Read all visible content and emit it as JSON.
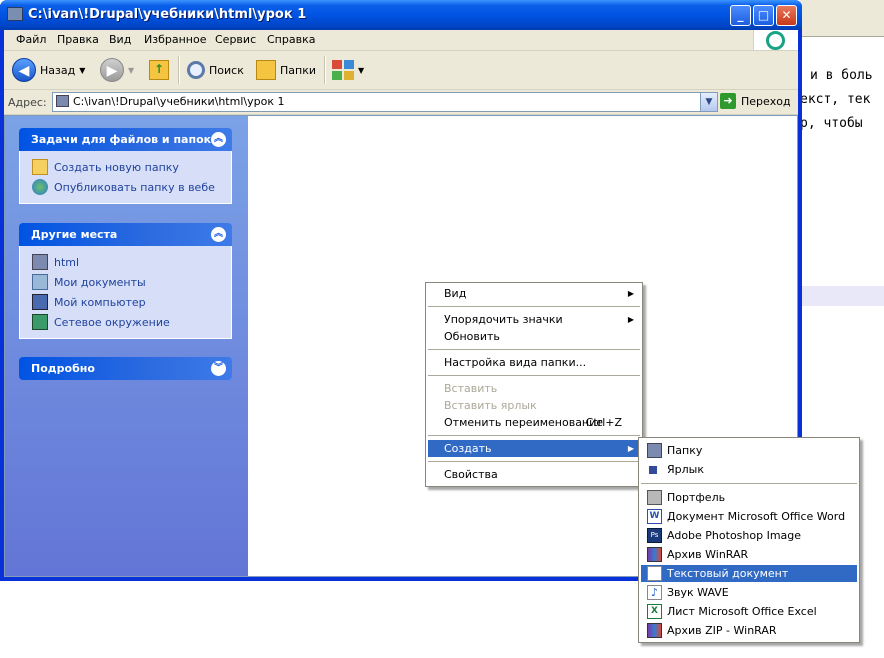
{
  "window": {
    "title": "C:\\ivan\\!Drupal\\учебники\\html\\урок 1",
    "minimize_label": "_",
    "maximize_label": "□",
    "close_label": "✕"
  },
  "menubar": [
    "Файл",
    "Правка",
    "Вид",
    "Избранное",
    "Сервис",
    "Справка"
  ],
  "toolbar": {
    "back_label": "Назад",
    "search_label": "Поиск",
    "folders_label": "Папки"
  },
  "address": {
    "label": "Адрес:",
    "value": "C:\\ivan\\!Drupal\\учебники\\html\\урок 1",
    "go_label": "Переход"
  },
  "task_panels": [
    {
      "title": "Задачи для файлов и папок",
      "links": [
        "Создать новую папку",
        "Опубликовать папку в вебе"
      ]
    },
    {
      "title": "Другие места",
      "links": [
        "html",
        "Мои документы",
        "Мой компьютер",
        "Сетевое окружение"
      ]
    },
    {
      "title": "Подробно",
      "links": []
    }
  ],
  "context_menu": {
    "view": "Вид",
    "arrange": "Упорядочить значки",
    "refresh": "Обновить",
    "customize": "Настройка вида папки...",
    "paste": "Вставить",
    "paste_shortcut": "Вставить ярлык",
    "undo_rename": "Отменить переименование",
    "undo_key": "Ctrl+Z",
    "create": "Создать",
    "properties": "Свойства"
  },
  "submenu": {
    "folder": "Папку",
    "shortcut": "Ярлык",
    "briefcase": "Портфель",
    "word": "Документ Microsoft Office Word",
    "photoshop": "Adobe Photoshop Image",
    "winrar": "Архив WinRAR",
    "text": "Текстовый документ",
    "wave": "Звук WAVE",
    "excel": "Лист Microsoft Office Excel",
    "zip": "Архив ZIP - WinRAR"
  },
  "background_doc": {
    "line1": "и в боль",
    "line2": "екст, тек",
    "line3": "р, чтобы"
  }
}
